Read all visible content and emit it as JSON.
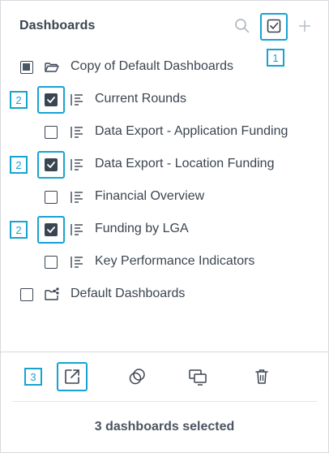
{
  "header": {
    "title": "Dashboards",
    "icons": {
      "search": "search-icon",
      "select": "checkbox-check-icon",
      "add": "plus-icon"
    }
  },
  "annotations": {
    "select_badge": "1",
    "checkbox_badge": "2",
    "export_badge": "3",
    "accent_color": "#17a3d1"
  },
  "tree": {
    "items": [
      {
        "label": "Copy of Default Dashboards",
        "type": "folder",
        "state": "indeterminate",
        "icon": "folder-open-icon"
      },
      {
        "label": "Current Rounds",
        "type": "dashboard",
        "state": "checked",
        "icon": "dashboard-list-icon"
      },
      {
        "label": "Data Export - Application Funding",
        "type": "dashboard",
        "state": "unchecked",
        "icon": "dashboard-list-icon"
      },
      {
        "label": "Data Export - Location Funding",
        "type": "dashboard",
        "state": "checked",
        "icon": "dashboard-list-icon"
      },
      {
        "label": "Financial Overview",
        "type": "dashboard",
        "state": "unchecked",
        "icon": "dashboard-list-icon"
      },
      {
        "label": "Funding by LGA",
        "type": "dashboard",
        "state": "checked",
        "icon": "dashboard-list-icon"
      },
      {
        "label": "Key Performance Indicators",
        "type": "dashboard",
        "state": "unchecked",
        "icon": "dashboard-list-icon"
      },
      {
        "label": "Default Dashboards",
        "type": "folder",
        "state": "unchecked",
        "icon": "shared-folder-icon"
      }
    ]
  },
  "toolbar": {
    "icons": [
      "export-icon",
      "duplicate-icon",
      "share-screens-icon",
      "trash-icon"
    ]
  },
  "footer": {
    "status": "3 dashboards selected"
  }
}
